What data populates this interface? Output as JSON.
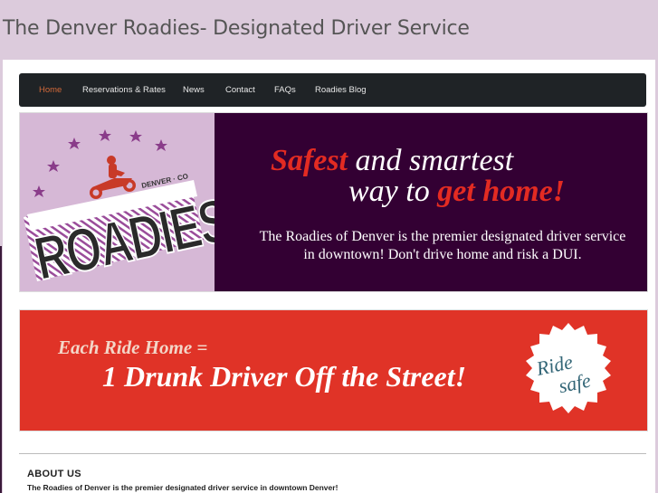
{
  "header": {
    "site_title": "The Denver Roadies- Designated Driver Service"
  },
  "nav": {
    "items": [
      {
        "label": "Home",
        "active": true
      },
      {
        "label": "Reservations & Rates",
        "active": false
      },
      {
        "label": "News",
        "active": false
      },
      {
        "label": "Contact",
        "active": false
      },
      {
        "label": "FAQs",
        "active": false
      },
      {
        "label": "Roadies Blog",
        "active": false
      }
    ]
  },
  "hero": {
    "logo": {
      "word": "ROADIES",
      "location": "DENVER · CO"
    },
    "tagline_line1": {
      "highlight": "Safest",
      "rest": " and smartest"
    },
    "tagline_line2": {
      "start": "way to ",
      "highlight": "get home!"
    },
    "description": "The Roadies of Denver is the premier designated driver service in downtown! Don't drive home and risk a DUI."
  },
  "banner": {
    "line1": "Each Ride Home =",
    "line2": "1 Drunk Driver Off the Street!",
    "badge": {
      "word1": "Ride",
      "word2": "safe"
    }
  },
  "about": {
    "heading": "ABOUT US",
    "text": "The Roadies of Denver is the premier designated driver service in downtown Denver!"
  },
  "colors": {
    "background": "#dccbdc",
    "nav_bg": "#1f2326",
    "nav_active": "#d2693a",
    "hero_dark": "#330033",
    "hero_logo_bg": "#d6b8d6",
    "accent_red": "#e32b22",
    "banner_red": "#e03327"
  }
}
